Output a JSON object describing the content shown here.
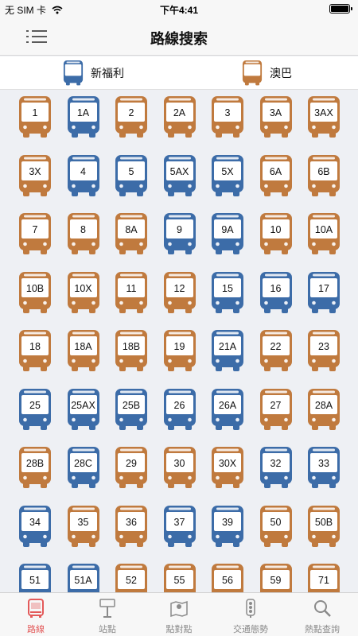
{
  "status_bar": {
    "carrier": "无 SIM 卡",
    "time": "下午4:41"
  },
  "nav": {
    "title": "路線搜索"
  },
  "legend": [
    {
      "label": "新福利",
      "operator": "nwfb",
      "color": "#3c6ca8"
    },
    {
      "label": "澳巴",
      "operator": "kmb",
      "color": "#c07a3e"
    }
  ],
  "colors": {
    "nwfb": "#3c6ca8",
    "kmb": "#c07a3e",
    "active_tab": "#e35a5a",
    "inactive_tab": "#8a8a8a"
  },
  "routes": [
    {
      "label": "1",
      "operator": "kmb"
    },
    {
      "label": "1A",
      "operator": "nwfb"
    },
    {
      "label": "2",
      "operator": "kmb"
    },
    {
      "label": "2A",
      "operator": "kmb"
    },
    {
      "label": "3",
      "operator": "kmb"
    },
    {
      "label": "3A",
      "operator": "kmb"
    },
    {
      "label": "3AX",
      "operator": "kmb"
    },
    {
      "label": "3X",
      "operator": "kmb"
    },
    {
      "label": "4",
      "operator": "nwfb"
    },
    {
      "label": "5",
      "operator": "nwfb"
    },
    {
      "label": "5AX",
      "operator": "nwfb"
    },
    {
      "label": "5X",
      "operator": "nwfb"
    },
    {
      "label": "6A",
      "operator": "kmb"
    },
    {
      "label": "6B",
      "operator": "kmb"
    },
    {
      "label": "7",
      "operator": "kmb"
    },
    {
      "label": "8",
      "operator": "kmb"
    },
    {
      "label": "8A",
      "operator": "kmb"
    },
    {
      "label": "9",
      "operator": "nwfb"
    },
    {
      "label": "9A",
      "operator": "nwfb"
    },
    {
      "label": "10",
      "operator": "kmb"
    },
    {
      "label": "10A",
      "operator": "kmb"
    },
    {
      "label": "10B",
      "operator": "kmb"
    },
    {
      "label": "10X",
      "operator": "kmb"
    },
    {
      "label": "11",
      "operator": "kmb"
    },
    {
      "label": "12",
      "operator": "kmb"
    },
    {
      "label": "15",
      "operator": "nwfb"
    },
    {
      "label": "16",
      "operator": "nwfb"
    },
    {
      "label": "17",
      "operator": "nwfb"
    },
    {
      "label": "18",
      "operator": "kmb"
    },
    {
      "label": "18A",
      "operator": "kmb"
    },
    {
      "label": "18B",
      "operator": "kmb"
    },
    {
      "label": "19",
      "operator": "kmb"
    },
    {
      "label": "21A",
      "operator": "nwfb"
    },
    {
      "label": "22",
      "operator": "kmb"
    },
    {
      "label": "23",
      "operator": "kmb"
    },
    {
      "label": "25",
      "operator": "nwfb"
    },
    {
      "label": "25AX",
      "operator": "nwfb"
    },
    {
      "label": "25B",
      "operator": "nwfb"
    },
    {
      "label": "26",
      "operator": "nwfb"
    },
    {
      "label": "26A",
      "operator": "nwfb"
    },
    {
      "label": "27",
      "operator": "kmb"
    },
    {
      "label": "28A",
      "operator": "kmb"
    },
    {
      "label": "28B",
      "operator": "kmb"
    },
    {
      "label": "28C",
      "operator": "nwfb"
    },
    {
      "label": "29",
      "operator": "kmb"
    },
    {
      "label": "30",
      "operator": "kmb"
    },
    {
      "label": "30X",
      "operator": "kmb"
    },
    {
      "label": "32",
      "operator": "nwfb"
    },
    {
      "label": "33",
      "operator": "nwfb"
    },
    {
      "label": "34",
      "operator": "nwfb"
    },
    {
      "label": "35",
      "operator": "kmb"
    },
    {
      "label": "36",
      "operator": "kmb"
    },
    {
      "label": "37",
      "operator": "nwfb"
    },
    {
      "label": "39",
      "operator": "nwfb"
    },
    {
      "label": "50",
      "operator": "kmb"
    },
    {
      "label": "50B",
      "operator": "kmb"
    },
    {
      "label": "51",
      "operator": "nwfb"
    },
    {
      "label": "51A",
      "operator": "nwfb"
    },
    {
      "label": "52",
      "operator": "kmb"
    },
    {
      "label": "55",
      "operator": "kmb"
    },
    {
      "label": "56",
      "operator": "kmb"
    },
    {
      "label": "59",
      "operator": "kmb"
    },
    {
      "label": "71",
      "operator": "kmb"
    }
  ],
  "tabs": [
    {
      "label": "路線",
      "icon": "bus-icon",
      "active": true
    },
    {
      "label": "站點",
      "icon": "bus-stop-sign-icon",
      "active": false
    },
    {
      "label": "點對點",
      "icon": "map-pin-icon",
      "active": false
    },
    {
      "label": "交通態勢",
      "icon": "traffic-light-icon",
      "active": false
    },
    {
      "label": "熱點查詢",
      "icon": "search-icon",
      "active": false
    }
  ]
}
